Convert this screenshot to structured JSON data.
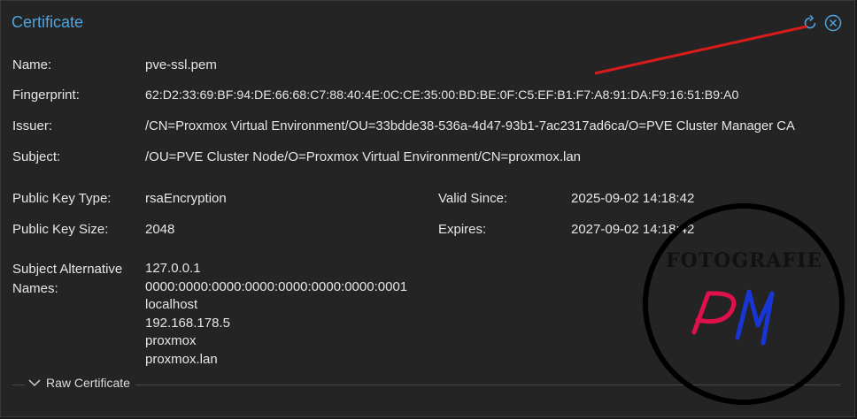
{
  "window": {
    "title": "Certificate"
  },
  "fields": {
    "name": {
      "label": "Name:",
      "value": "pve-ssl.pem"
    },
    "fingerprint": {
      "label": "Fingerprint:",
      "value": "62:D2:33:69:BF:94:DE:66:68:C7:88:40:4E:0C:CE:35:00:BD:BE:0F:C5:EF:B1:F7:A8:91:DA:F9:16:51:B9:A0"
    },
    "issuer": {
      "label": "Issuer:",
      "value": "/CN=Proxmox Virtual Environment/OU=33bdde38-536a-4d47-93b1-7ac2317ad6ca/O=PVE Cluster Manager CA"
    },
    "subject": {
      "label": "Subject:",
      "value": "/OU=PVE Cluster Node/O=Proxmox Virtual Environment/CN=proxmox.lan"
    },
    "public_key_type": {
      "label": "Public Key Type:",
      "value": "rsaEncryption"
    },
    "public_key_size": {
      "label": "Public Key Size:",
      "value": "2048"
    },
    "valid_since": {
      "label": "Valid Since:",
      "value": "2025-09-02 14:18:42"
    },
    "expires": {
      "label": "Expires:",
      "value": "2027-09-02 14:18:42"
    },
    "san": {
      "label": "Subject Alternative Names:",
      "values": [
        "127.0.0.1",
        "0000:0000:0000:0000:0000:0000:0000:0001",
        "localhost",
        "192.168.178.5",
        "proxmox",
        "proxmox.lan"
      ]
    }
  },
  "raw_certificate": {
    "label": "Raw Certificate",
    "expanded": false
  },
  "icons": {
    "refresh": "refresh-icon",
    "close": "close-icon",
    "expand": "chevron-down-icon"
  },
  "watermark": {
    "text": "FOTOGRAFIE",
    "initials": "PM",
    "colors": {
      "ring": "#000000",
      "p": "#e0104a",
      "m": "#1836d6"
    }
  },
  "colors": {
    "title": "#4fa3e0",
    "text": "#e6e6e6",
    "annotation_arrow": "#d81c1c"
  }
}
